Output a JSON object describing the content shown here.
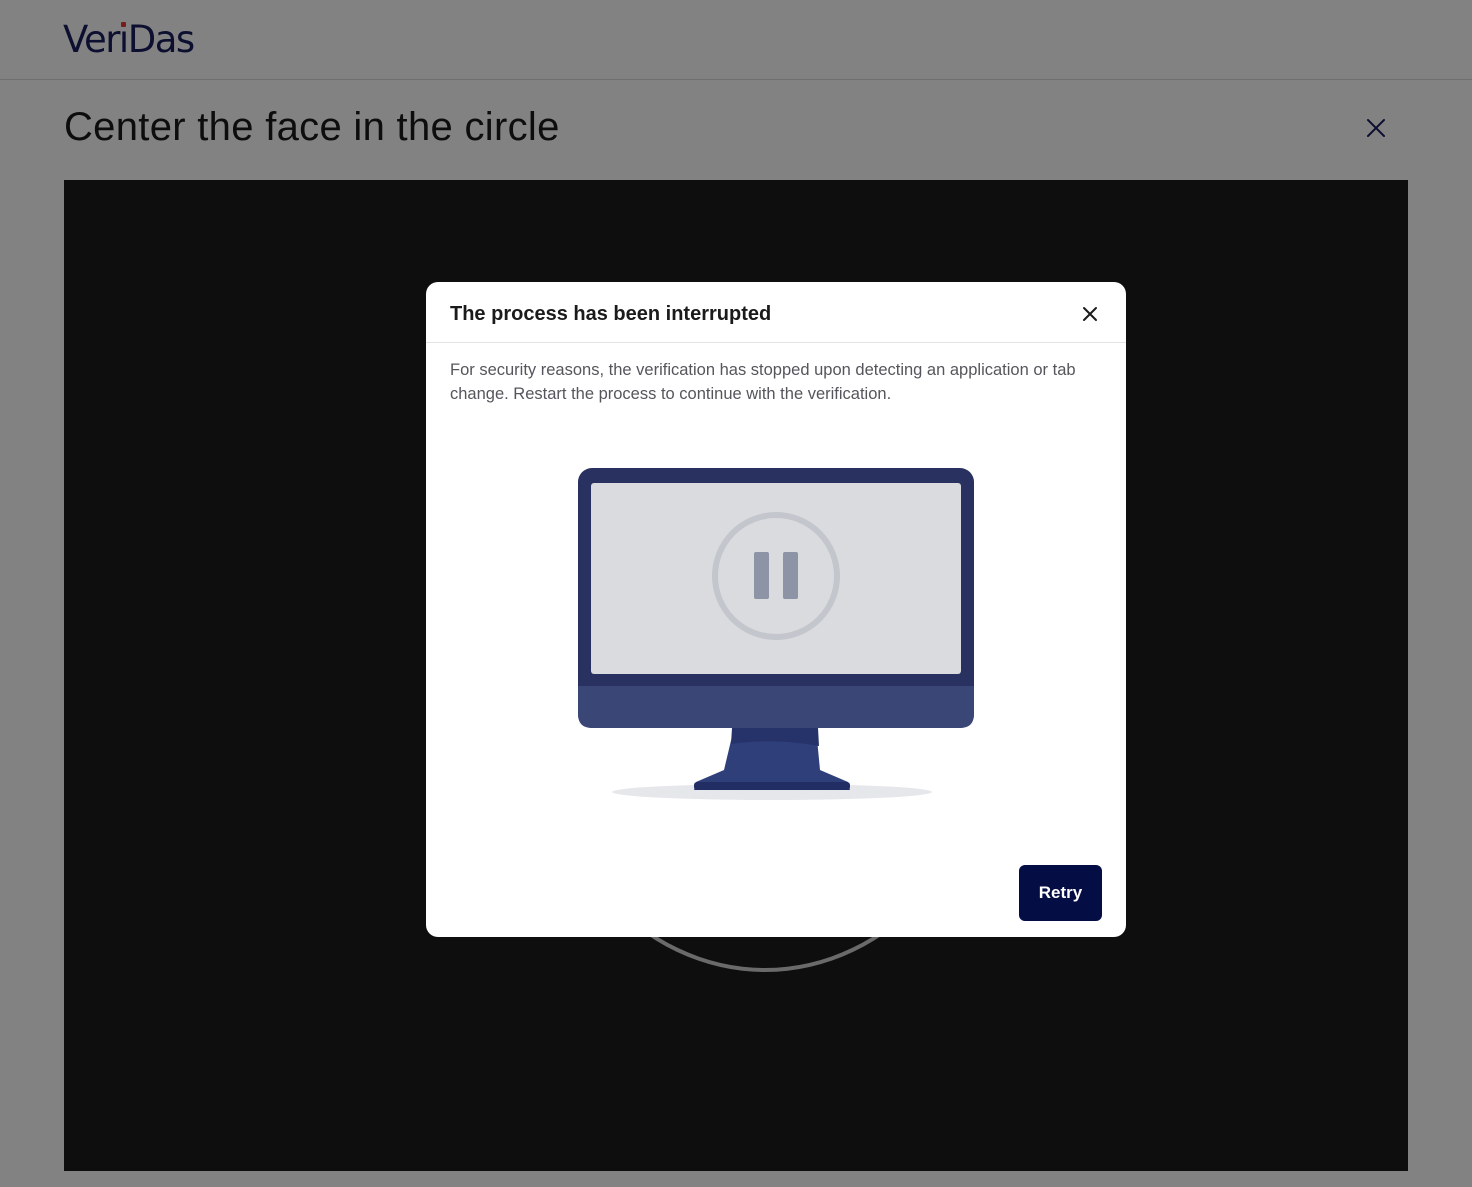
{
  "header": {
    "logo_text_prefix": "Ver",
    "logo_text_i": "ı",
    "logo_text_suffix": "Das",
    "accent_dot_color": "#e53935",
    "brand_color": "#1a1f5e"
  },
  "page": {
    "title": "Center the face in the circle",
    "close_icon": "close-icon"
  },
  "camera": {
    "background_color": "#1c1c1c",
    "guide_shape": "face-oval-guide"
  },
  "modal": {
    "title": "The process has been interrupted",
    "close_icon": "close-icon",
    "message": "For security reasons, the verification has stopped upon detecting an application or tab change. Restart the process to continue with the verification.",
    "illustration": "monitor-pause-illustration",
    "retry_label": "Retry",
    "retry_color": "#050d45"
  }
}
